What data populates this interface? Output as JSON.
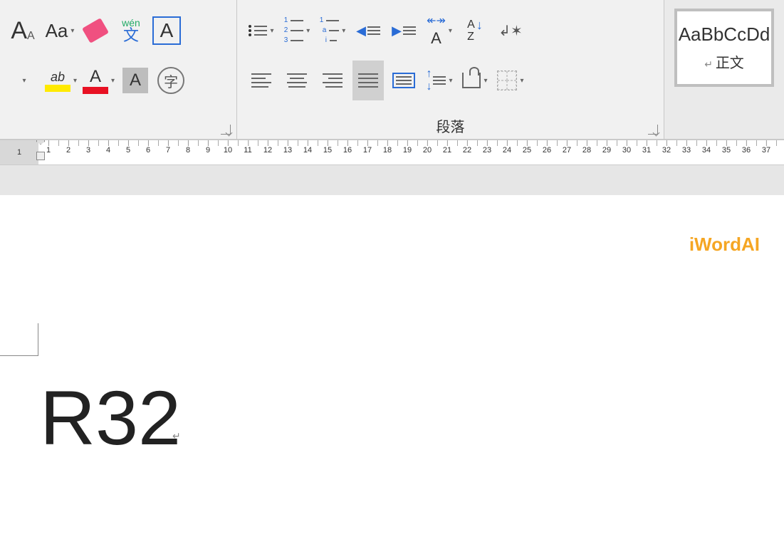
{
  "ribbon": {
    "font_group": {
      "grow_font": "A",
      "shrink_font": "A",
      "change_case": "Aa",
      "phonetic_top": "wén",
      "phonetic_char": "文",
      "char_border": "A",
      "highlight_label": "ab",
      "font_color_label": "A",
      "shading_label": "A",
      "enclose_char": "字"
    },
    "para_group": {
      "label": "段落",
      "sort_a": "A",
      "sort_z": "Z"
    },
    "style": {
      "sample": "AaBbCcDd",
      "name": "正文"
    }
  },
  "ruler": {
    "neg": "1",
    "marks": [
      "1",
      "2",
      "3",
      "4",
      "5",
      "6",
      "7",
      "8",
      "9",
      "10",
      "11",
      "12",
      "13",
      "14",
      "15",
      "16",
      "17",
      "18",
      "19",
      "20",
      "21",
      "22",
      "23",
      "24",
      "25",
      "26",
      "27",
      "28",
      "29",
      "30",
      "31",
      "32",
      "33",
      "34",
      "35",
      "36",
      "37"
    ]
  },
  "document": {
    "watermark": "iWordAI",
    "content": "R32",
    "para_mark": "↵"
  }
}
